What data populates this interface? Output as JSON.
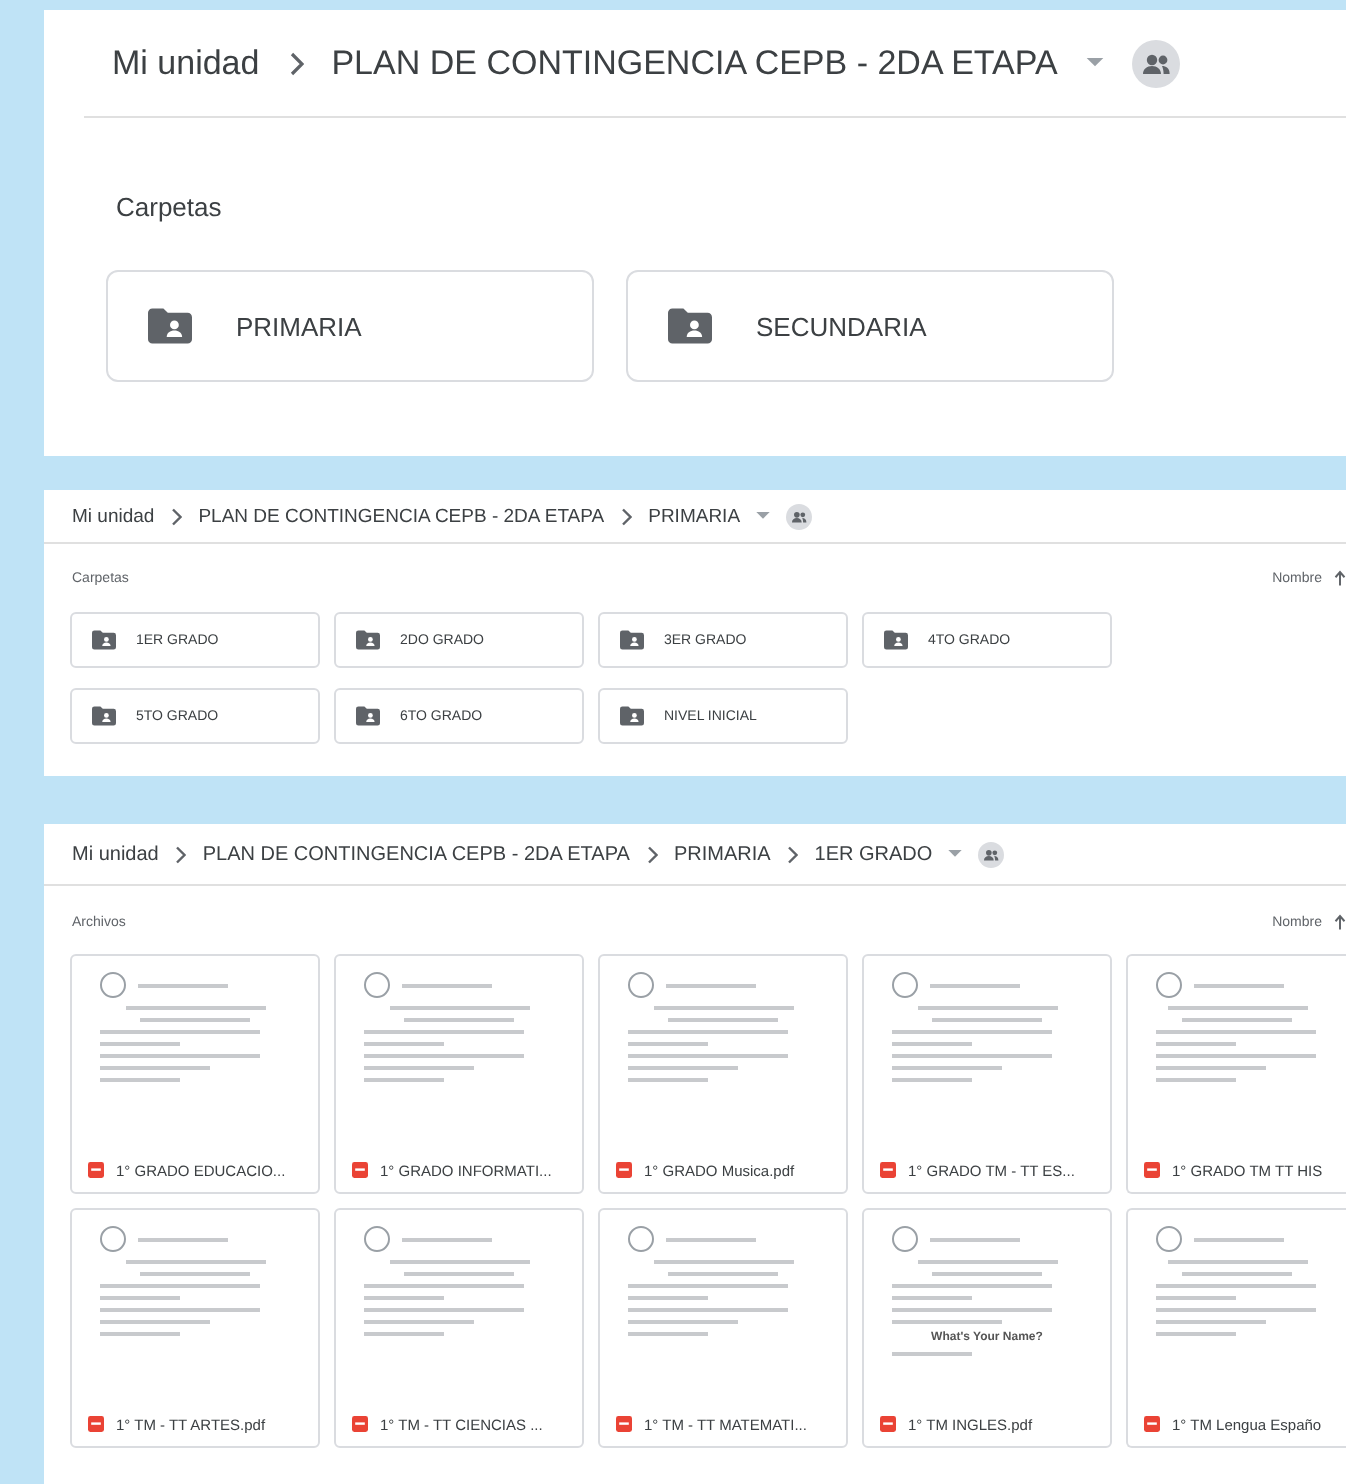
{
  "panels": [
    {
      "kind": "large",
      "breadcrumb": [
        "Mi unidad",
        "PLAN DE CONTINGENCIA CEPB - 2DA ETAPA"
      ],
      "section": "Carpetas",
      "folders": [
        "PRIMARIA",
        "SECUNDARIA"
      ]
    },
    {
      "kind": "compact",
      "breadcrumb": [
        "Mi unidad",
        "PLAN DE CONTINGENCIA CEPB - 2DA ETAPA",
        "PRIMARIA"
      ],
      "section": "Carpetas",
      "sort": "Nombre",
      "folders": [
        "1ER GRADO",
        "2DO GRADO",
        "3ER GRADO",
        "4TO GRADO",
        "5TO GRADO",
        "6TO GRADO",
        "NIVEL INICIAL"
      ]
    },
    {
      "kind": "compact",
      "breadcrumb": [
        "Mi unidad",
        "PLAN DE CONTINGENCIA CEPB - 2DA ETAPA",
        "PRIMARIA",
        "1ER GRADO"
      ],
      "section": "Archivos",
      "sort": "Nombre",
      "files": [
        {
          "name": "1° GRADO EDUCACIO..."
        },
        {
          "name": "1° GRADO INFORMATI..."
        },
        {
          "name": "1° GRADO Musica.pdf"
        },
        {
          "name": "1° GRADO TM - TT ES..."
        },
        {
          "name": "1° GRADO TM TT HIS"
        },
        {
          "name": "1° TM - TT ARTES.pdf"
        },
        {
          "name": "1° TM - TT CIENCIAS ..."
        },
        {
          "name": "1° TM - TT MATEMATI..."
        },
        {
          "name": "1° TM INGLES.pdf",
          "preview_text": "What's Your Name?"
        },
        {
          "name": "1° TM Lengua Españo"
        }
      ]
    }
  ]
}
